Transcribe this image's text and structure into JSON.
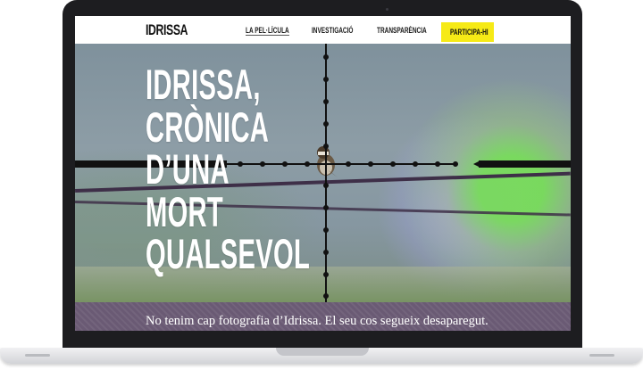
{
  "navbar": {
    "logo": "IDRISSA",
    "links": [
      {
        "label": "LA PEL·LÍCULA"
      },
      {
        "label": "INVESTIGACIÓ"
      },
      {
        "label": "TRANSPARÈNCIA"
      }
    ],
    "cta": "PARTICIPA-HI"
  },
  "hero": {
    "title": "IDRISSA,\nCRÒNICA\nD’UNA\nMORT\nQUALSEVOL"
  },
  "caption": "No tenim cap fotografia d’Idrissa. El seu cos segueix desaparegut.",
  "colors": {
    "cta_background": "#f6ea16",
    "caption_background": "#6a5a74",
    "laptop_frame": "#1d1d20"
  }
}
